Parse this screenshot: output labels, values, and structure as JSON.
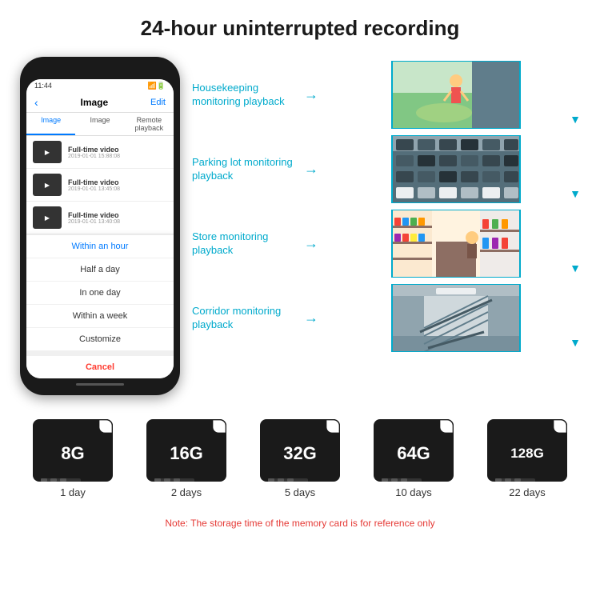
{
  "header": {
    "title": "24-hour uninterrupted recording"
  },
  "phone": {
    "status_time": "11:44",
    "nav_back": "‹",
    "nav_title": "Image",
    "nav_edit": "Edit",
    "tabs": [
      "Image",
      "Image",
      "Remote playback"
    ],
    "videos": [
      {
        "title": "Full-time video",
        "date": "2019-01-01 15:88:08"
      },
      {
        "title": "Full-time video",
        "date": "2019-01-01 13:45:08"
      },
      {
        "title": "Full-time video",
        "date": "2019-01-01 13:40:08"
      }
    ],
    "dropdown_items": [
      {
        "label": "Within an hour",
        "selected": true
      },
      {
        "label": "Half a day",
        "selected": false
      },
      {
        "label": "In one day",
        "selected": false
      },
      {
        "label": "Within a week",
        "selected": false
      },
      {
        "label": "Customize",
        "selected": false
      }
    ],
    "cancel_label": "Cancel"
  },
  "monitoring": [
    {
      "label": "Housekeeping monitoring playback",
      "image_type": "housekeeping",
      "emoji": "🏠"
    },
    {
      "label": "Parking lot monitoring playback",
      "image_type": "parking",
      "emoji": "🚗"
    },
    {
      "label": "Store monitoring playback",
      "image_type": "store",
      "emoji": "🏪"
    },
    {
      "label": "Corridor monitoring playback",
      "image_type": "corridor",
      "emoji": "🏢"
    }
  ],
  "sd_cards": [
    {
      "size": "8G",
      "days": "1 day"
    },
    {
      "size": "16G",
      "days": "2 days"
    },
    {
      "size": "32G",
      "days": "5 days"
    },
    {
      "size": "64G",
      "days": "10 days"
    },
    {
      "size": "128G",
      "days": "22 days"
    }
  ],
  "note": {
    "text": "Note: The storage time of the memory card is for reference only"
  }
}
